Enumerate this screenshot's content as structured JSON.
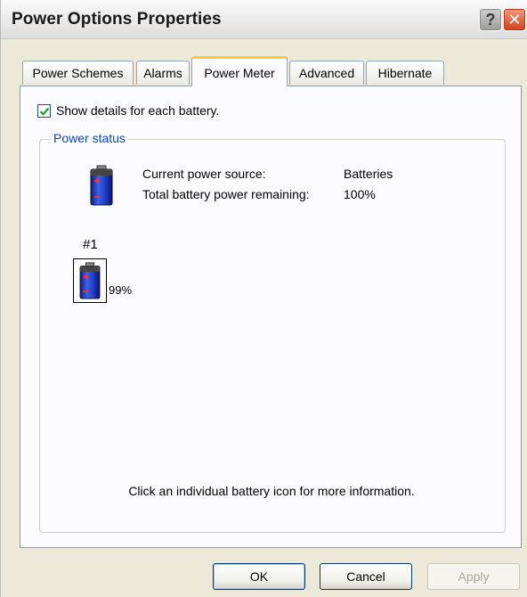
{
  "window": {
    "title": "Power Options Properties",
    "help_glyph": "?",
    "close_glyph": "✕"
  },
  "tabs": [
    {
      "label": "Power Schemes",
      "active": false
    },
    {
      "label": "Alarms",
      "active": false
    },
    {
      "label": "Power Meter",
      "active": true
    },
    {
      "label": "Advanced",
      "active": false
    },
    {
      "label": "Hibernate",
      "active": false
    }
  ],
  "power_meter": {
    "show_details_label": "Show details for each battery.",
    "show_details_checked": true,
    "group_title": "Power status",
    "current_source_label": "Current power source:",
    "current_source_value": "Batteries",
    "total_remaining_label": "Total battery power remaining:",
    "total_remaining_value": "100%",
    "batteries": [
      {
        "number": "#1",
        "percent": "99%"
      }
    ],
    "hint": "Click an individual battery icon for more information."
  },
  "buttons": {
    "ok": "OK",
    "cancel": "Cancel",
    "apply": "Apply"
  },
  "colors": {
    "dialog_bg": "#ece9d8",
    "tab_page_bg": "#fcfcfe",
    "group_title": "#0046d5",
    "active_tab_accent": "#ffc83c",
    "close_button": "#d2411c"
  },
  "icons": {
    "battery": "battery-icon",
    "check": "checkmark-icon",
    "help": "help-icon",
    "close": "close-icon"
  }
}
